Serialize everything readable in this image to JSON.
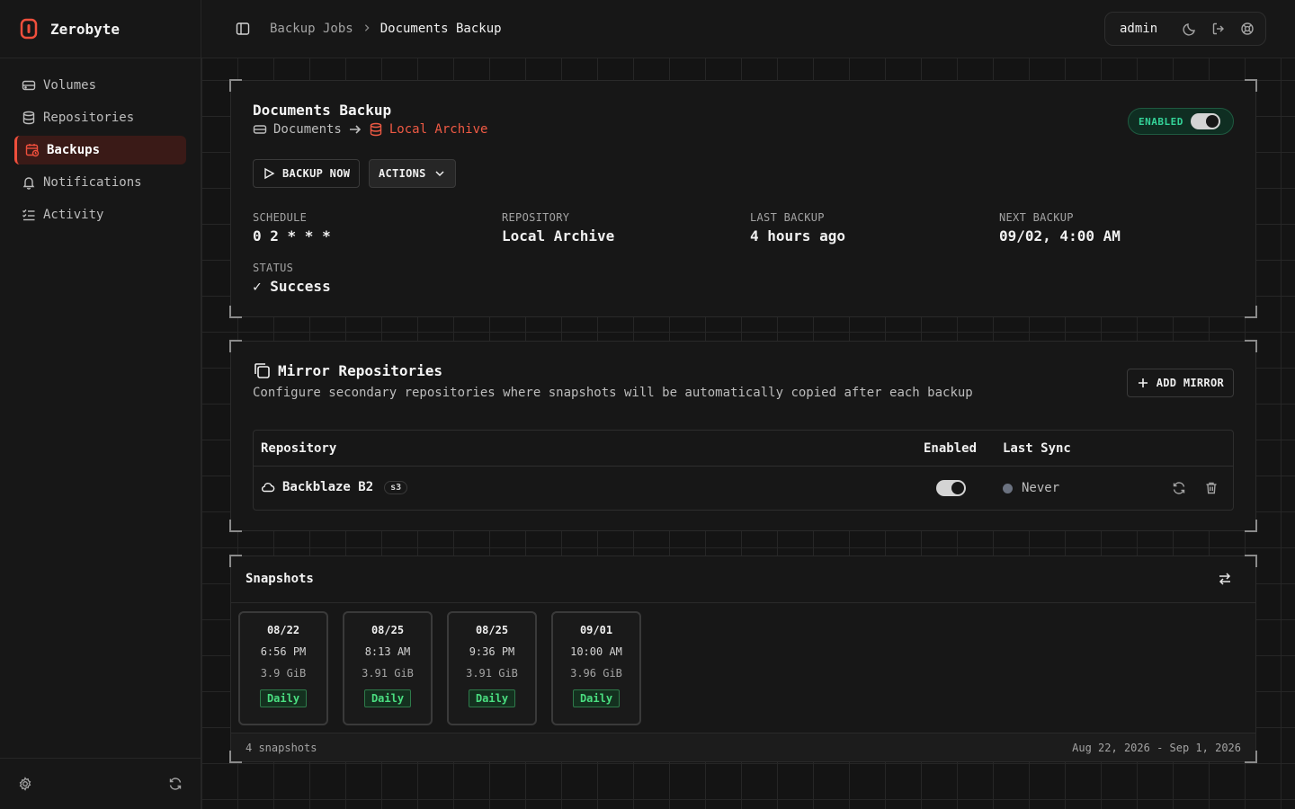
{
  "app": {
    "name": "Zerobyte",
    "accent": "#ef4f3c"
  },
  "sidebar": {
    "items": [
      {
        "label": "Volumes",
        "icon": "hard-drive-icon"
      },
      {
        "label": "Repositories",
        "icon": "database-icon"
      },
      {
        "label": "Backups",
        "icon": "calendar-clock-icon",
        "active": true
      },
      {
        "label": "Notifications",
        "icon": "bell-icon"
      },
      {
        "label": "Activity",
        "icon": "list-checks-icon"
      }
    ]
  },
  "header": {
    "breadcrumb": [
      "Backup Jobs",
      "Documents Backup"
    ],
    "user": "admin"
  },
  "job": {
    "title": "Documents Backup",
    "source": "Documents",
    "destination": "Local Archive",
    "status_badge": "ENABLED",
    "backup_now_label": "BACKUP NOW",
    "actions_label": "ACTIONS",
    "stats": {
      "schedule_label": "SCHEDULE",
      "schedule_value": "0 2 * * *",
      "repository_label": "REPOSITORY",
      "repository_value": "Local Archive",
      "last_label": "LAST BACKUP",
      "last_value": "4 hours ago",
      "next_label": "NEXT BACKUP",
      "next_value": "09/02, 4:00 AM",
      "status_label": "STATUS",
      "status_value": "✓ Success"
    }
  },
  "mirrors": {
    "title": "Mirror Repositories",
    "description": "Configure secondary repositories where snapshots will be automatically copied after each backup",
    "add_label": "ADD MIRROR",
    "columns": {
      "repository": "Repository",
      "enabled": "Enabled",
      "last_sync": "Last Sync"
    },
    "rows": [
      {
        "name": "Backblaze B2",
        "type": "s3",
        "enabled": true,
        "last_sync": "Never"
      }
    ]
  },
  "snapshots": {
    "title": "Snapshots",
    "items": [
      {
        "date": "08/22",
        "time": "6:56 PM",
        "size": "3.9 GiB",
        "tag": "Daily"
      },
      {
        "date": "08/25",
        "time": "8:13 AM",
        "size": "3.91 GiB",
        "tag": "Daily"
      },
      {
        "date": "08/25",
        "time": "9:36 PM",
        "size": "3.91 GiB",
        "tag": "Daily"
      },
      {
        "date": "09/01",
        "time": "10:00 AM",
        "size": "3.96 GiB",
        "tag": "Daily"
      }
    ],
    "count_label": "4 snapshots",
    "range_label": "Aug 22, 2026 - Sep 1, 2026"
  }
}
